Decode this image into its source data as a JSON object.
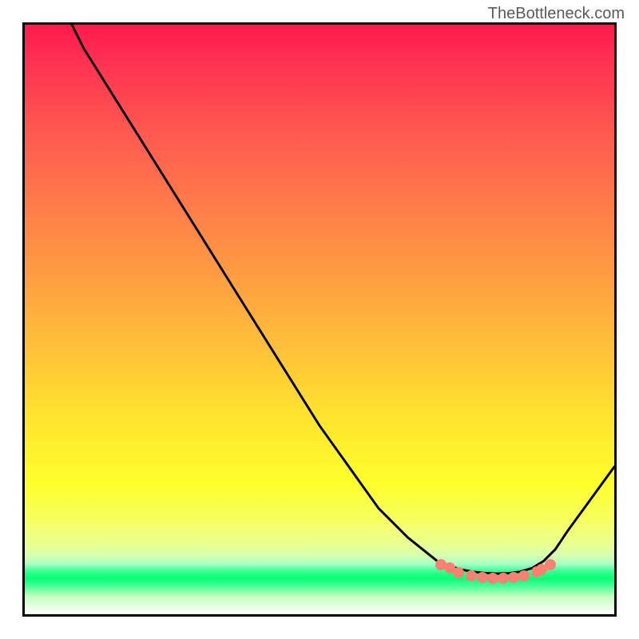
{
  "watermark": "TheBottleneck.com",
  "chart_data": {
    "type": "line",
    "title": "",
    "xlabel": "",
    "ylabel": "",
    "xlim": [
      0,
      100
    ],
    "ylim": [
      0,
      100
    ],
    "grid": false,
    "legend": false,
    "series": [
      {
        "name": "curve",
        "x": [
          8,
          10,
          15,
          20,
          25,
          30,
          35,
          40,
          45,
          50,
          55,
          60,
          65,
          70,
          72,
          74,
          76,
          78,
          80,
          82,
          84,
          86,
          88,
          90,
          92,
          100
        ],
        "y": [
          100,
          96,
          88,
          80,
          72,
          64,
          56,
          48,
          40,
          32,
          25,
          18,
          13,
          9,
          8.2,
          7.6,
          7.2,
          7.0,
          6.9,
          6.95,
          7.2,
          7.8,
          9,
          11,
          14,
          25
        ]
      }
    ],
    "markers": [
      {
        "x": 70,
        "y": 9.2
      },
      {
        "x": 71.5,
        "y": 8.6
      },
      {
        "x": 73,
        "y": 7.8
      },
      {
        "x": 75.2,
        "y": 7.2
      },
      {
        "x": 77.0,
        "y": 6.95
      },
      {
        "x": 78.8,
        "y": 6.85
      },
      {
        "x": 80.5,
        "y": 6.85
      },
      {
        "x": 82.2,
        "y": 6.95
      },
      {
        "x": 84.0,
        "y": 7.2
      },
      {
        "x": 86.2,
        "y": 7.9
      },
      {
        "x": 87.0,
        "y": 8.3
      },
      {
        "x": 88.4,
        "y": 9.2
      }
    ],
    "background": {
      "type": "vertical-gradient",
      "stops": [
        {
          "pos": 0,
          "color": "#ff1a4d"
        },
        {
          "pos": 0.5,
          "color": "#ffb23d"
        },
        {
          "pos": 0.8,
          "color": "#feff2b"
        },
        {
          "pos": 0.93,
          "color": "#1aff82"
        },
        {
          "pos": 1.0,
          "color": "#ffffff"
        }
      ]
    }
  }
}
